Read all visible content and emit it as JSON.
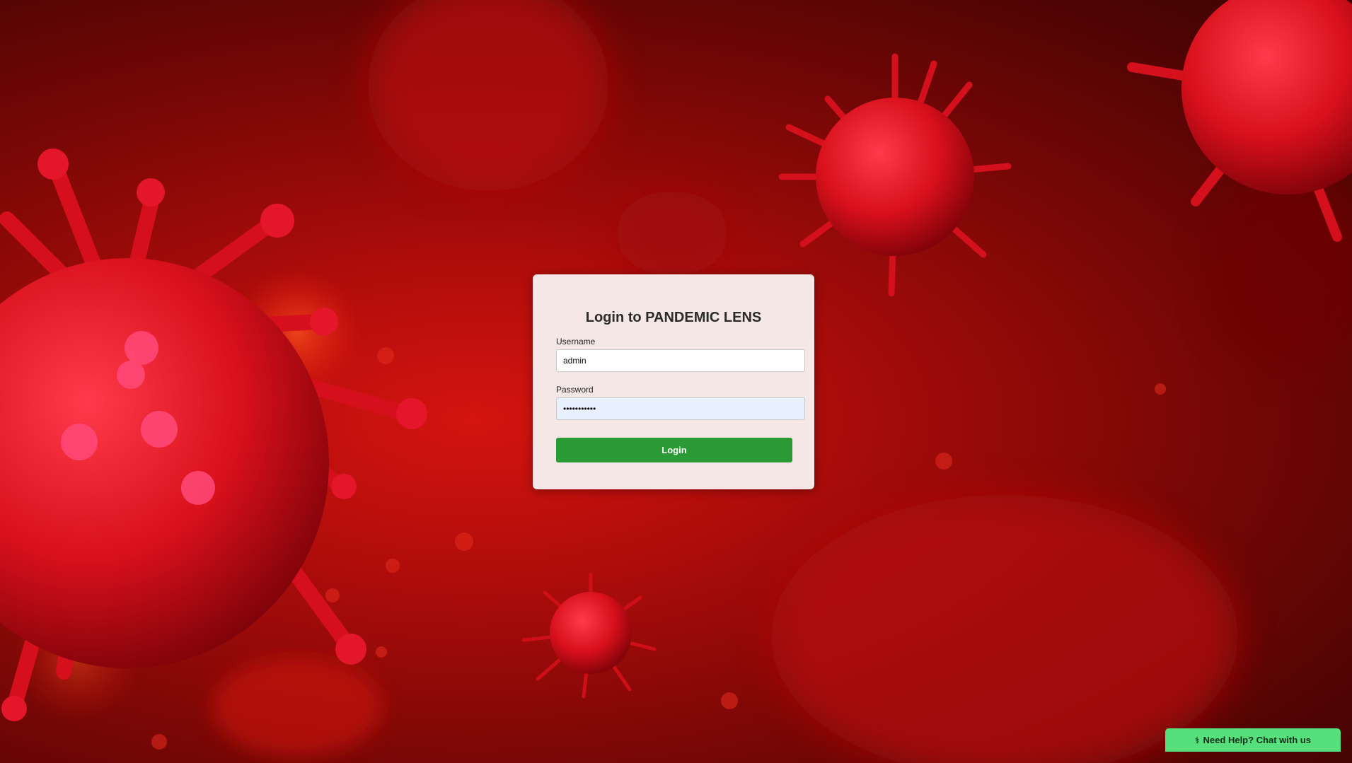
{
  "colors": {
    "background_red": "#b10d0b",
    "card_background": "#f4e7e6",
    "login_button": "#2a9a34",
    "chat_button": "#56e07c",
    "password_field_autofill": "#e8f0fe"
  },
  "login": {
    "title": "Login to PANDEMIC LENS",
    "username_label": "Username",
    "username_value": "admin",
    "password_label": "Password",
    "password_value": "•••••••••••",
    "button_label": "Login"
  },
  "chat": {
    "icon": "stethoscope-icon",
    "icon_glyph": "⚕",
    "label": "Need Help? Chat with us"
  }
}
